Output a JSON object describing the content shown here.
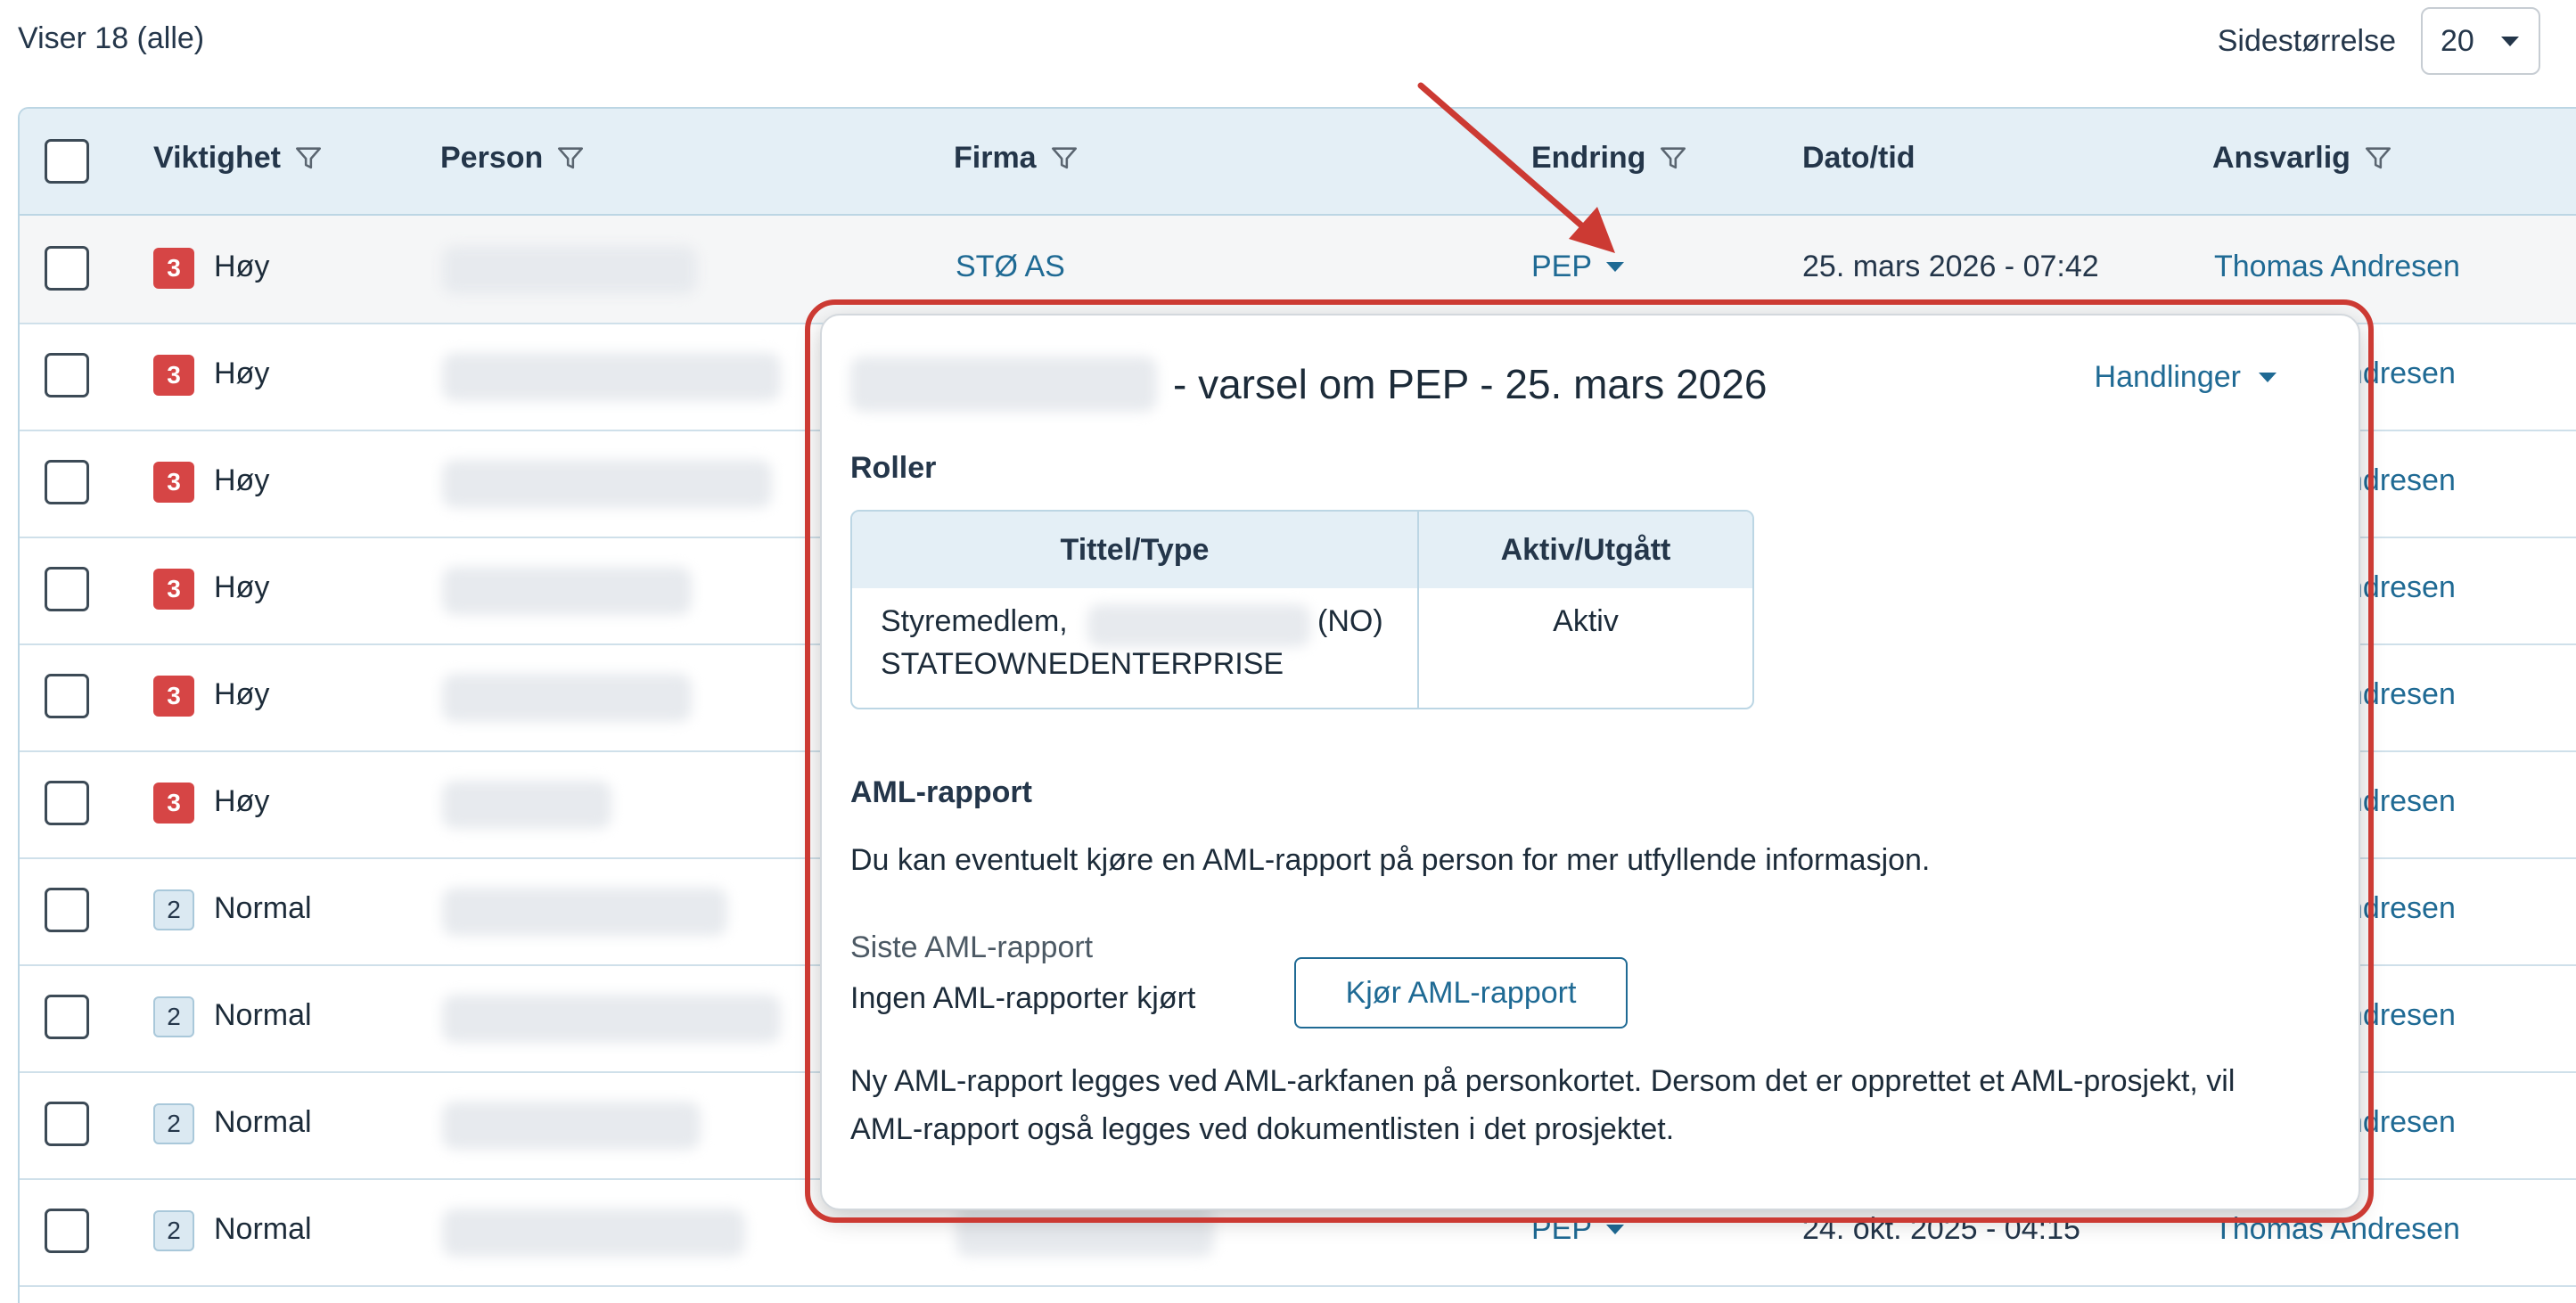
{
  "topbar": {
    "showing": "Viser 18 (alle)",
    "page_size_label": "Sidestørrelse",
    "page_size_value": "20"
  },
  "table": {
    "columns": {
      "priority": "Viktighet",
      "person": "Person",
      "company": "Firma",
      "change": "Endring",
      "datetime": "Dato/tid",
      "responsible": "Ansvarlig"
    },
    "rows": [
      {
        "level": "3",
        "priority": "Høy",
        "company": "STØ AS",
        "change": "PEP",
        "datetime": "25. mars 2026 - 07:42",
        "responsible": "Thomas Andresen"
      },
      {
        "level": "3",
        "priority": "Høy",
        "responsible_partial": "ndresen"
      },
      {
        "level": "3",
        "priority": "Høy",
        "responsible_partial": "ndresen"
      },
      {
        "level": "3",
        "priority": "Høy",
        "responsible_partial": "ndresen"
      },
      {
        "level": "3",
        "priority": "Høy",
        "responsible_partial": "ndresen"
      },
      {
        "level": "3",
        "priority": "Høy",
        "responsible_partial": "ndresen"
      },
      {
        "level": "2",
        "priority": "Normal",
        "responsible_partial": "ndresen"
      },
      {
        "level": "2",
        "priority": "Normal",
        "responsible_partial": "ndresen"
      },
      {
        "level": "2",
        "priority": "Normal",
        "responsible_partial": "ndresen"
      },
      {
        "level": "2",
        "priority": "Normal",
        "change": "PEP",
        "datetime": "24. okt. 2025 - 04:15",
        "responsible": "Thomas Andresen"
      }
    ]
  },
  "popup": {
    "title_suffix": "- varsel om PEP - 25. mars 2026",
    "actions_label": "Handlinger",
    "roles_heading": "Roller",
    "roles_table": {
      "col_title": "Tittel/Type",
      "col_status": "Aktiv/Utgått",
      "rows": [
        {
          "title_prefix": "Styremedlem,",
          "country": "(NO)",
          "type": "STATEOWNEDENTERPRISE",
          "status": "Aktiv"
        }
      ]
    },
    "aml_heading": "AML-rapport",
    "aml_intro": "Du kan eventuelt kjøre en AML-rapport på person for mer utfyllende informasjon.",
    "last_report_label": "Siste AML-rapport",
    "last_report_value": "Ingen AML-rapporter kjørt",
    "run_button": "Kjør AML-rapport",
    "aml_note": "Ny AML-rapport legges ved AML-arkfanen på personkortet. Dersom det er opprettet et AML-prosjekt, vil AML-rapport også legges ved dokumentlisten i det prosjektet."
  },
  "colors": {
    "accent": "#1f6a94",
    "high_badge": "#d64545",
    "annotation": "#cc3a33",
    "header_bg": "#e4eff6"
  }
}
